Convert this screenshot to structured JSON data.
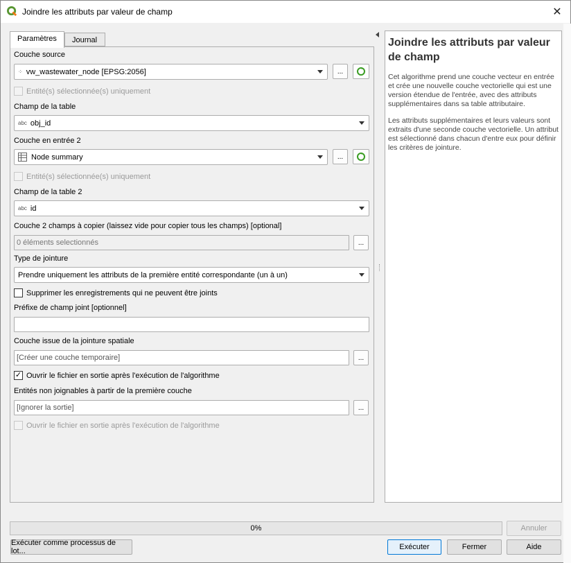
{
  "window": {
    "title": "Joindre les attributs par valeur de champ"
  },
  "tabs": [
    {
      "label": "Paramètres"
    },
    {
      "label": "Journal"
    }
  ],
  "params": {
    "source_layer_label": "Couche source",
    "source_layer_value": "vw_wastewater_node [EPSG:2056]",
    "selected_only_1": "Entité(s) sélectionnée(s) uniquement",
    "table_field_label": "Champ de la table",
    "table_field_value": "obj_id",
    "input_layer2_label": "Couche en entrée 2",
    "input_layer2_value": "Node summary",
    "selected_only_2": "Entité(s) sélectionnée(s) uniquement",
    "table_field2_label": "Champ de la table 2",
    "table_field2_value": "id",
    "fields_to_copy_label": "Couche 2 champs à copier (laissez vide pour copier tous les champs) [optional]",
    "fields_to_copy_value": "0 éléments selectionnés",
    "join_type_label": "Type de jointure",
    "join_type_value": "Prendre uniquement les attributs de la première entité correspondante (un à un)",
    "discard_label": "Supprimer les enregistrements qui ne peuvent être joints",
    "prefix_label": "Préfixe de champ joint [optionnel]",
    "prefix_value": "",
    "output_label": "Couche issue de la jointure spatiale",
    "output_placeholder": "[Créer une couche temporaire]",
    "open_output_1": "Ouvrir le fichier en sortie après l'exécution de l'algorithme",
    "unjoinable_label": "Entités non joignables à partir de la première couche",
    "unjoinable_placeholder": "[Ignorer la sortie]",
    "open_output_2": "Ouvrir le fichier en sortie après l'exécution de l'algorithme",
    "type_abc": "abc",
    "browse": "..."
  },
  "help": {
    "title": "Joindre les attributs par valeur de champ",
    "p1": "Cet algorithme prend une couche vecteur en entrée et crée une nouvelle couche vectorielle qui est une version étendue de l'entrée, avec des attributs supplémentaires dans sa table attributaire.",
    "p2": "Les attributs supplémentaires et leurs valeurs sont extraits d'une seconde couche vectorielle. Un attribut est sélectionné dans chacun d'entre eux pour définir les critères de jointure."
  },
  "footer": {
    "progress_text": "0%",
    "progress_value": 0,
    "cancel": "Annuler",
    "batch": "Exécuter comme processus de lot...",
    "run": "Exécuter",
    "close": "Fermer",
    "help": "Aide"
  }
}
